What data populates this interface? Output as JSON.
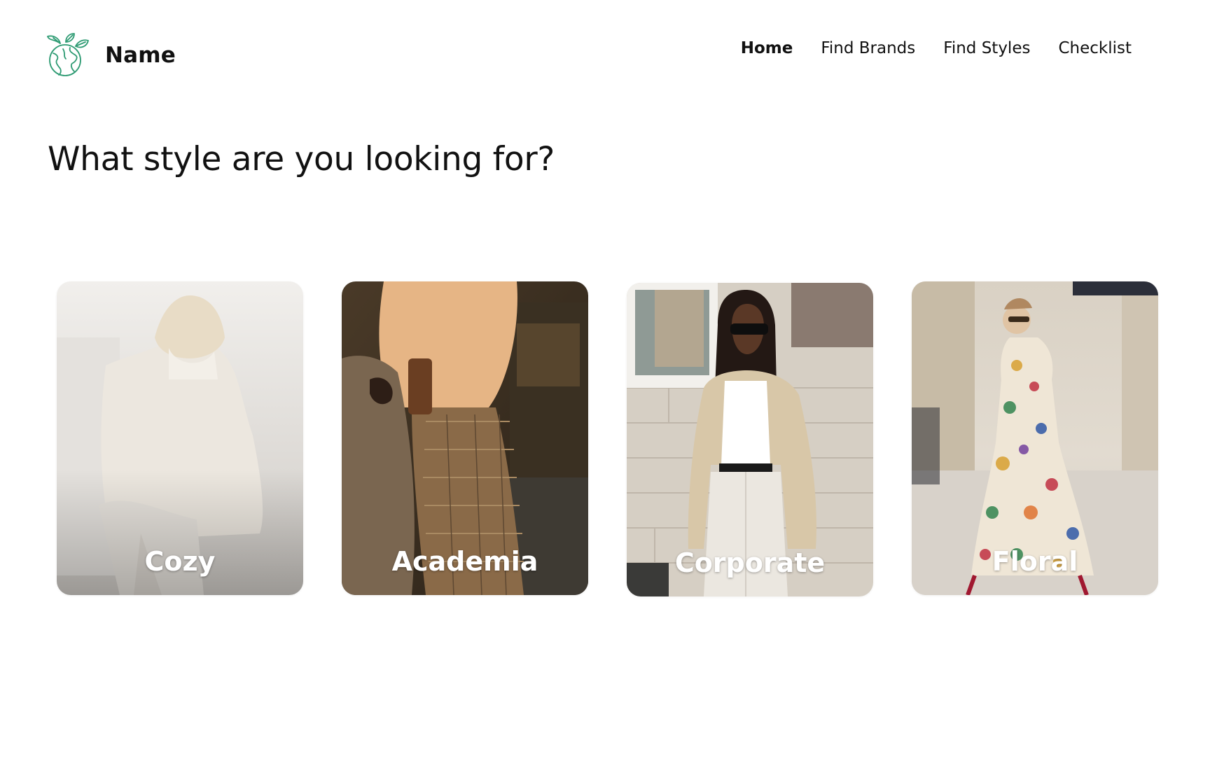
{
  "header": {
    "brand_name": "Name",
    "logo_icon": "earth-leaf-icon",
    "accent_color": "#2e9b73",
    "nav": [
      {
        "label": "Home",
        "active": true
      },
      {
        "label": "Find Brands",
        "active": false
      },
      {
        "label": "Find Styles",
        "active": false
      },
      {
        "label": "Checklist",
        "active": false
      }
    ]
  },
  "main": {
    "heading": "What style are you looking for?",
    "styles": [
      {
        "label": "Cozy"
      },
      {
        "label": "Academia"
      },
      {
        "label": "Corporate"
      },
      {
        "label": "Floral"
      }
    ]
  }
}
